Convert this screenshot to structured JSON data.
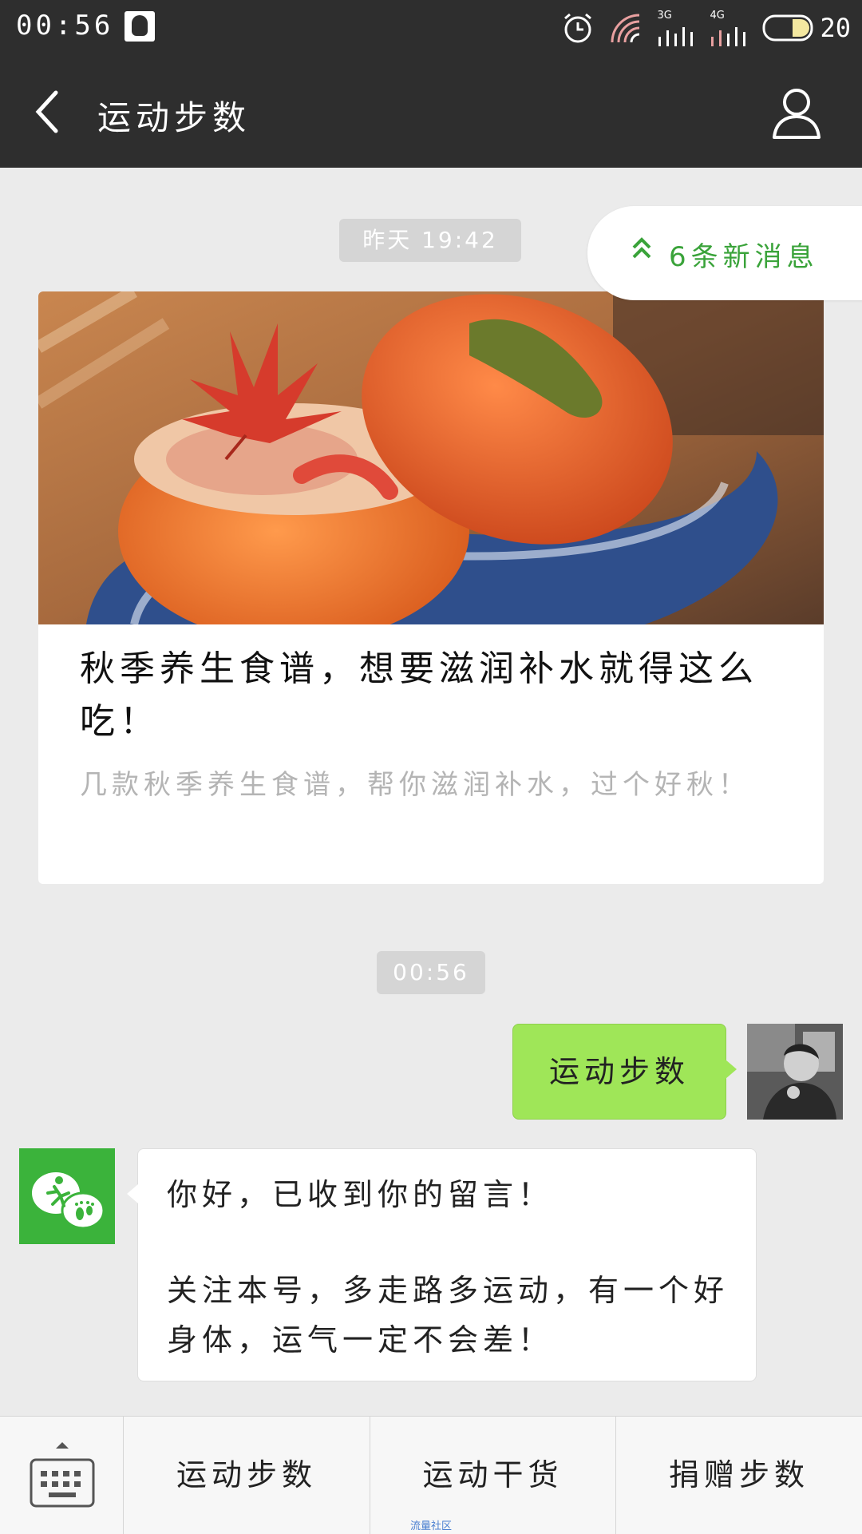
{
  "status_bar": {
    "time": "00:56",
    "network_labels": [
      "3G",
      "4G"
    ],
    "battery": "20"
  },
  "header": {
    "title": "运动步数"
  },
  "new_messages": {
    "label": "6条新消息"
  },
  "timestamps": {
    "first": "昨天 19:42",
    "second": "00:56"
  },
  "article": {
    "title": "秋季养生食谱，想要滋润补水就得这么吃！",
    "summary": "几款秋季养生食谱，帮你滋润补水，过个好秋！"
  },
  "messages": {
    "sent": "运动步数",
    "received_line1": "你好，已收到你的留言！",
    "received_line2": "关注本号，多走路多运动，有一个好身体，运气一定不会差！"
  },
  "bottom_menu": {
    "items": [
      "运动步数",
      "运动干货",
      "捐赠步数"
    ]
  },
  "watermark": "流量社区",
  "colors": {
    "accent_green": "#3aa33a",
    "bubble_green": "#9fe658",
    "bar_dark": "#2e2e2e"
  }
}
